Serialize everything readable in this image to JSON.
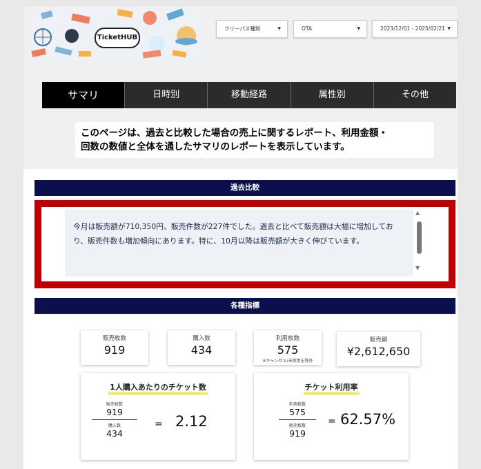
{
  "brand": {
    "logo_text": "TicketHUB"
  },
  "filters": [
    {
      "value": "フリーパス種別"
    },
    {
      "value": "OTA"
    },
    {
      "value": "2023/12/01 - 2025/02/21"
    }
  ],
  "tabs": [
    "サマリ",
    "日時別",
    "移動経路",
    "属性別",
    "その他"
  ],
  "description": {
    "line1": "このページは、過去と比較した場合の売上に関するレポート、利用金額・",
    "line2": "回数の数値と全体を通したサマリのレポートを表示しています。"
  },
  "comparison": {
    "title": "過去比較",
    "comment": "今月は販売額が710,350円、販売件数が227件でした。過去と比べて販売額は大幅に増加しており、販売件数も増加傾向にあります。特に、10月以降は販売額が大きく伸びています。"
  },
  "indicators": {
    "title": "各種指標",
    "cards": [
      {
        "label": "販売枚数",
        "value": "919"
      },
      {
        "label": "購入数",
        "value": "434"
      },
      {
        "label": "利用枚数",
        "value": "575",
        "note": "※キャンセル/未使用を除外"
      },
      {
        "label": "販売額",
        "value": "¥2,612,650"
      }
    ],
    "per_person": {
      "title": "1人購入あたりのチケット数",
      "num_label": "販売枚数",
      "num": "919",
      "den_label": "購入数",
      "den": "434",
      "eq": "=",
      "result": "2.12"
    },
    "usage_rate": {
      "title": "チケット利用率",
      "num_label": "利用枚数",
      "num": "575",
      "den_label": "販売枚数",
      "den": "919",
      "eq": "=",
      "result": "62.57%"
    }
  },
  "colors": {
    "section_header": "#0b0f4d",
    "highlight_border": "#c00000",
    "tab_bg": "#1f1f1f",
    "title_underline": "#f4ea2a"
  }
}
